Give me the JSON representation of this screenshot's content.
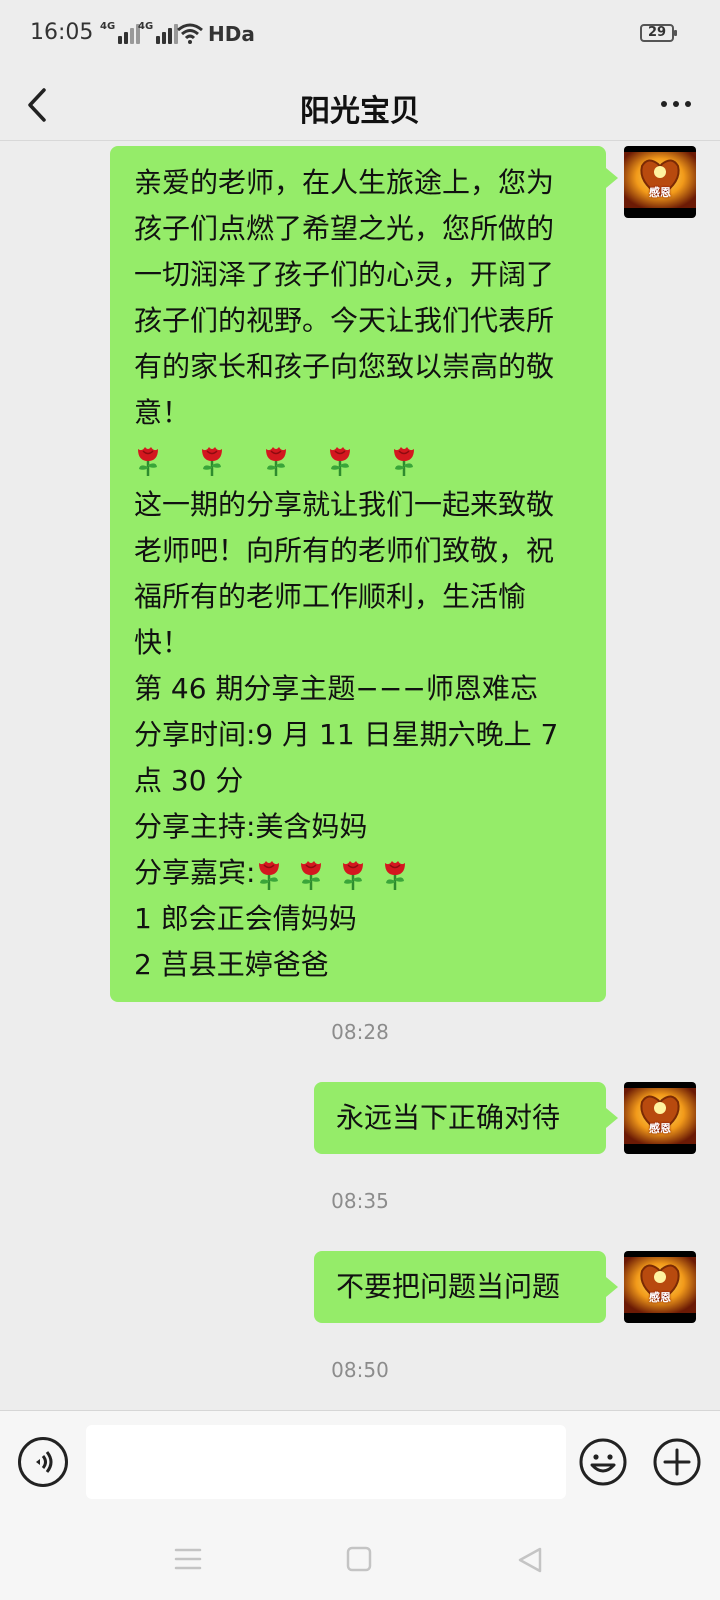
{
  "status_bar": {
    "time": "16:05",
    "signal1_label": "4G",
    "signal2_label": "4G",
    "hd_label": "HDa",
    "battery": "29"
  },
  "header": {
    "title": "阳光宝贝",
    "back_icon": "chevron-left-icon",
    "more_icon": "more-dots-icon"
  },
  "messages": [
    {
      "sender": "self",
      "lines": [
        "亲爱的老师，在人生旅途上，您为",
        "孩子们点燃了希望之光，您所做的",
        "一切润泽了孩子们的心灵，开阔了",
        "孩子们的视野。今天让我们代表所",
        "有的家长和孩子向您致以崇高的敬",
        "意！",
        "这一期的分享就让我们一起来致敬",
        "老师吧！向所有的老师们致敬，祝",
        "福所有的老师工作顺利，生活愉",
        "快！",
        "第 46 期分享主题−−−师恩难忘",
        "分享时间:9 月 11 日星期六晚上 7",
        "点 30 分",
        "分享主持:美含妈妈",
        "分享嘉宾:",
        "1 郎会正会倩妈妈",
        "2 莒县王婷爸爸"
      ],
      "rose_row_count": 5,
      "guest_rose_count": 4
    },
    {
      "sender": "self",
      "text": "永远当下正确对待"
    },
    {
      "sender": "self",
      "text": "不要把问题当问题"
    }
  ],
  "timestamps": [
    "08:28",
    "08:35",
    "08:50"
  ],
  "avatar": {
    "caption": "感恩",
    "icon": "heart-hands-avatar"
  },
  "input_bar": {
    "voice_icon": "voice-icon",
    "emoji_icon": "emoji-icon",
    "plus_icon": "plus-icon",
    "text_value": ""
  },
  "nav_bar": {
    "menu_icon": "menu-icon",
    "home_icon": "home-square-icon",
    "back_icon": "back-triangle-icon"
  },
  "colors": {
    "bubble": "#95ec69",
    "background": "#ededed",
    "timestamp": "#8c8c8c"
  }
}
